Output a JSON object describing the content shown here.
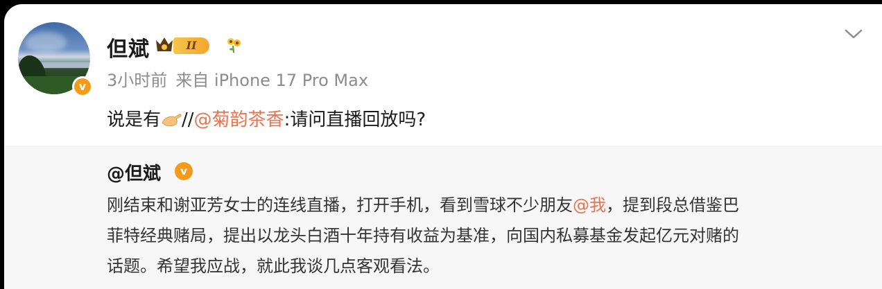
{
  "post": {
    "username": "但斌",
    "rank_badge": "II",
    "timestamp": "3小时前",
    "source": "来自 iPhone 17 Pro Max",
    "text_before": "说是有",
    "separator": "//",
    "mention": "@菊韵茶香",
    "text_after": ":请问直播回放吗?"
  },
  "repost": {
    "author": "@但斌",
    "verified_mark": "v",
    "line1_before": "刚结束和谢亚芳女士的连线直播，打开手机，看到雪球不少朋友",
    "line1_mention": "@我",
    "line1_after": "，提到段总借鉴巴",
    "line2": "菲特经典赌局，提出以龙头白酒十年持有收益为基准，向国内私募基金发起亿元对赌的",
    "line3": "话题。希望我应战，就此我谈几点客观看法。"
  },
  "icons": {
    "avatar_badge": "verified-v-icon",
    "rank": "crown-icon",
    "flower": "sunflower-icon",
    "menu": "chevron-down-icon",
    "hand": "pinching-hand-emoji"
  },
  "colors": {
    "mention": "#eb7350",
    "verified": "#f39b1a",
    "meta_text": "#8c8c8c",
    "repost_bg": "#f7f7f7"
  }
}
